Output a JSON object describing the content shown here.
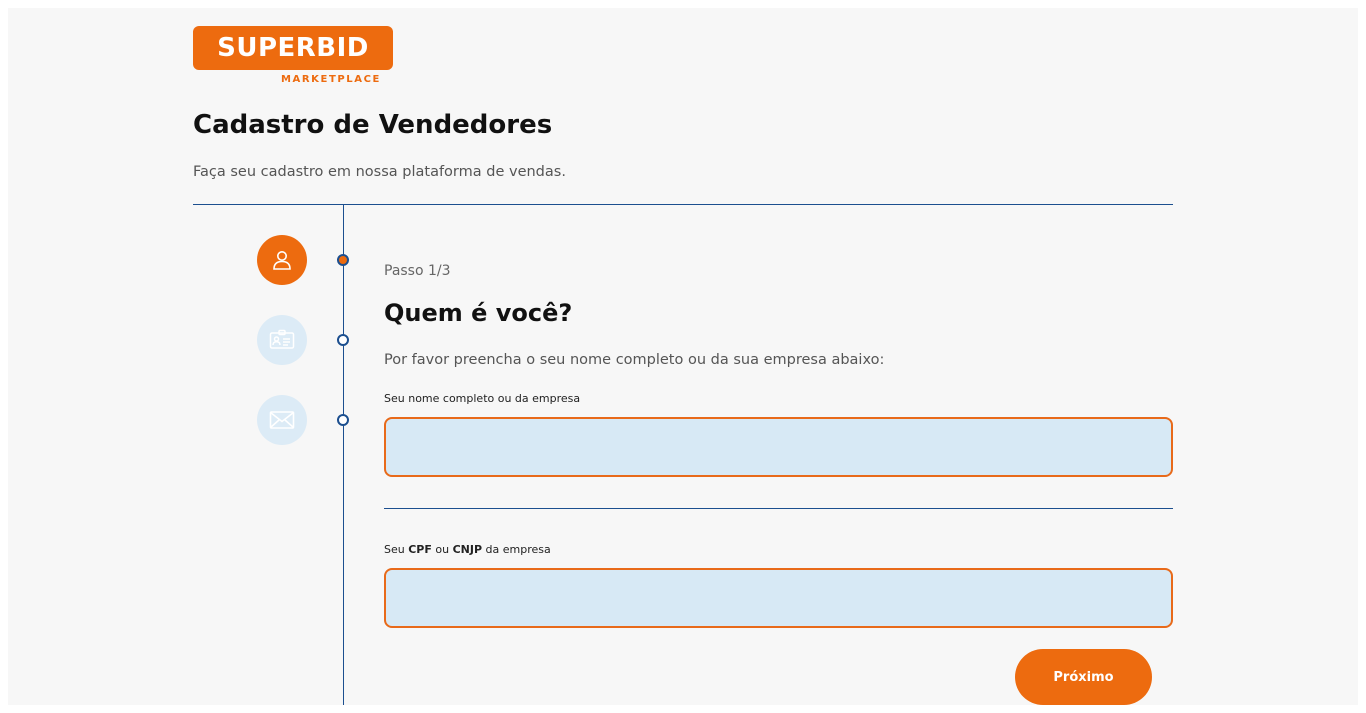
{
  "brand": {
    "name": "SUPERBID",
    "subtitle": "MARKETPLACE",
    "accent_color": "#ed6b0f"
  },
  "header": {
    "title": "Cadastro de Vendedores",
    "subtitle": "Faça seu cadastro em nossa plataforma de vendas."
  },
  "steps": [
    {
      "icon": "user-icon",
      "state": "active"
    },
    {
      "icon": "id-card-icon",
      "state": "inactive"
    },
    {
      "icon": "envelope-icon",
      "state": "inactive"
    }
  ],
  "form": {
    "step_label": "Passo 1/3",
    "title": "Quem é você?",
    "description": "Por favor preencha o seu nome completo ou da sua empresa abaixo:",
    "name_field": {
      "label": "Seu nome completo ou da empresa",
      "value": "",
      "placeholder": ""
    },
    "doc_field": {
      "label_prefix": "Seu ",
      "label_cpf": "CPF",
      "label_or": " ou ",
      "label_cnjp": "CNJP",
      "label_suffix": " da empresa",
      "value": "",
      "placeholder": ""
    },
    "next_button": "Próximo"
  }
}
